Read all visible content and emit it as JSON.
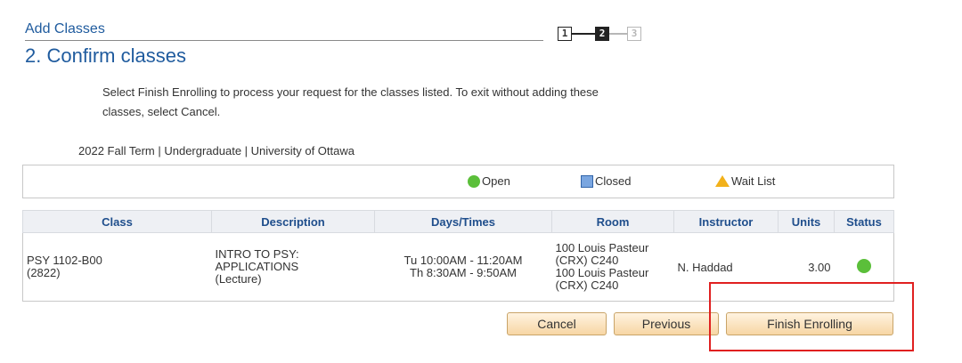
{
  "header": {
    "section": "Add Classes",
    "title": "2.  Confirm classes",
    "steps": [
      "1",
      "2",
      "3"
    ]
  },
  "instructions": "Select Finish Enrolling to process your request for the classes listed. To exit without adding these classes, select Cancel.",
  "term_info": "2022 Fall Term | Undergraduate | University of Ottawa",
  "legend": {
    "open": "Open",
    "closed": "Closed",
    "wait_list": "Wait List"
  },
  "table": {
    "headers": [
      "Class",
      "Description",
      "Days/Times",
      "Room",
      "Instructor",
      "Units",
      "Status"
    ],
    "rows": [
      {
        "class_code": "PSY 1102-B00",
        "class_number": "(2822)",
        "description": [
          "INTRO TO PSY:",
          "APPLICATIONS",
          "(Lecture)"
        ],
        "times": [
          "Tu 10:00AM - 11:20AM",
          "Th 8:30AM - 9:50AM"
        ],
        "room": [
          "100 Louis Pasteur",
          "(CRX) C240",
          "100 Louis Pasteur",
          "(CRX) C240"
        ],
        "instructor": "N. Haddad",
        "units": "3.00",
        "status": "Open"
      }
    ]
  },
  "buttons": {
    "cancel": "Cancel",
    "previous": "Previous",
    "finish": "Finish Enrolling"
  },
  "colors": {
    "heading": "#1f5b9e",
    "open": "#5bbf3a",
    "closed": "#7aa6e0",
    "wait_list": "#f2b11a",
    "highlight": "#e02020"
  }
}
